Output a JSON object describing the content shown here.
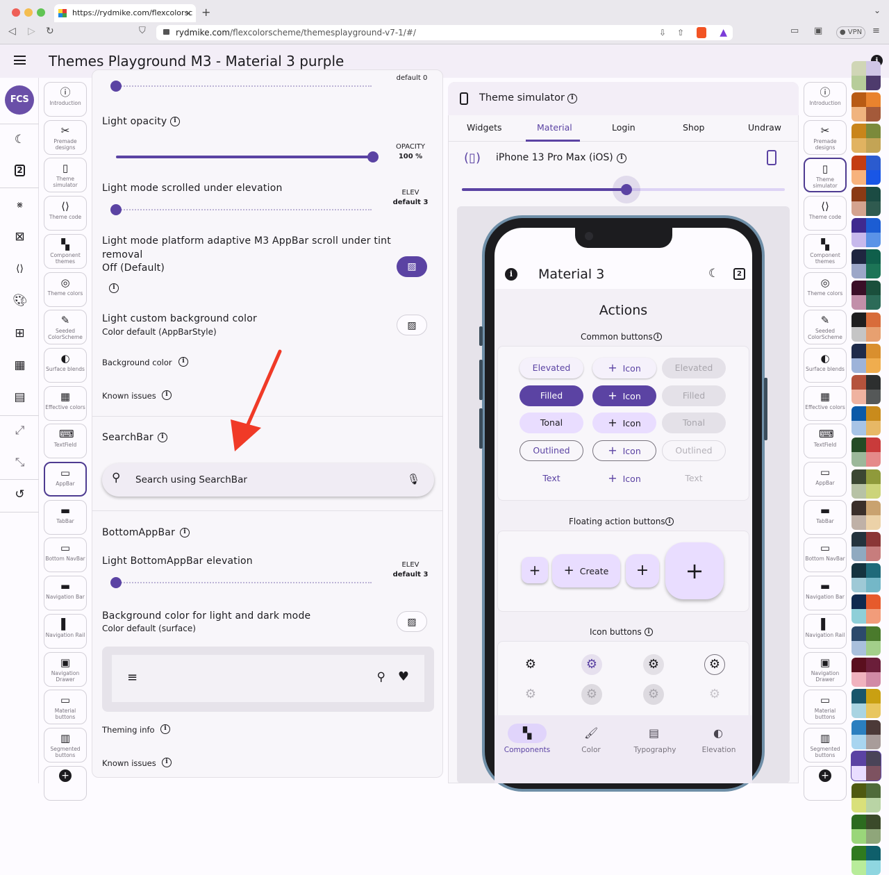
{
  "browser": {
    "tab_title": "https://rydmike.com/flexcolorsc",
    "tab_close": "×",
    "new_tab": "+",
    "url_domain": "rydmike.com",
    "url_path": "/flexcolorscheme/themesplayground-v7-1/#/",
    "vpn_label": "VPN"
  },
  "appbar": {
    "title": "Themes Playground M3 - Material 3 purple",
    "info": "i"
  },
  "rail": {
    "logo": "FCS"
  },
  "panel_nav": [
    {
      "icon": "info-icon",
      "label": "Introduction"
    },
    {
      "icon": "premade-designs-icon",
      "label": "Premade designs"
    },
    {
      "icon": "phone-icon",
      "label": "Theme simulator"
    },
    {
      "icon": "code-icon",
      "label": "Theme code"
    },
    {
      "icon": "widgets-icon",
      "label": "Component themes"
    },
    {
      "icon": "palette-icon",
      "label": "Theme colors"
    },
    {
      "icon": "colorize-icon",
      "label": "Seeded ColorScheme"
    },
    {
      "icon": "contrast-icon",
      "label": "Surface blends"
    },
    {
      "icon": "effective-colors-icon",
      "label": "Effective colors"
    },
    {
      "icon": "textfield-icon",
      "label": "TextField"
    },
    {
      "icon": "appbar-icon",
      "label": "AppBar"
    },
    {
      "icon": "tabbar-icon",
      "label": "TabBar"
    },
    {
      "icon": "bottom-navbar-icon",
      "label": "Bottom NavBar"
    },
    {
      "icon": "navigation-bar-icon",
      "label": "Navigation Bar"
    },
    {
      "icon": "navigation-rail-icon",
      "label": "Navigation Rail"
    },
    {
      "icon": "navigation-drawer-icon",
      "label": "Navigation Drawer"
    },
    {
      "icon": "material-buttons-icon",
      "label": "Material buttons"
    },
    {
      "icon": "segmented-buttons-icon",
      "label": "Segmented buttons"
    }
  ],
  "settings": {
    "top_value": "default 0",
    "light_opacity": {
      "label": "Light opacity",
      "caption": "OPACITY",
      "value": "100 %",
      "slider_fraction": 1.0
    },
    "scroll_elev": {
      "label": "Light mode scrolled under elevation",
      "caption": "ELEV",
      "value": "default 3"
    },
    "tint_removal": {
      "label": "Light mode platform adaptive M3 AppBar scroll under tint removal",
      "state": "Off (Default)"
    },
    "custom_bg": {
      "label": "Light custom background color",
      "subtitle": "Color default (AppBarStyle)"
    },
    "background_color": "Background color",
    "known_issues": "Known issues",
    "searchbar": {
      "title": "SearchBar",
      "placeholder": "Search using SearchBar"
    },
    "bottomappbar": {
      "title": "BottomAppBar",
      "elev_label": "Light BottomAppBar elevation",
      "caption": "ELEV",
      "value": "default 3",
      "bg_label": "Background color for light and dark mode",
      "bg_subtitle": "Color default (surface)"
    },
    "theming_info": "Theming info",
    "known_issues_2": "Known issues"
  },
  "simulator": {
    "title": "Theme simulator",
    "tabs": [
      "Widgets",
      "Material",
      "Login",
      "Shop",
      "Undraw"
    ],
    "selected_tab": "Material",
    "device": "iPhone 13 Pro Max (iOS)",
    "device_slider_fraction": 0.5,
    "phone": {
      "app_title": "Material 3",
      "actions_title": "Actions",
      "common_buttons": "Common buttons",
      "buttons": {
        "elevated": "Elevated",
        "filled": "Filled",
        "tonal": "Tonal",
        "outlined": "Outlined",
        "text": "Text",
        "icon": "Icon"
      },
      "fab_title": "Floating action buttons",
      "fab_create": "Create",
      "icon_buttons": "Icon buttons",
      "bottom_nav": [
        "Components",
        "Color",
        "Typography",
        "Elevation"
      ]
    }
  },
  "colors": {
    "primary": "#5b43a3",
    "primary_container": "#e9ddff",
    "surface": "#fdfbff",
    "annotation_arrow": "#f03a27"
  }
}
